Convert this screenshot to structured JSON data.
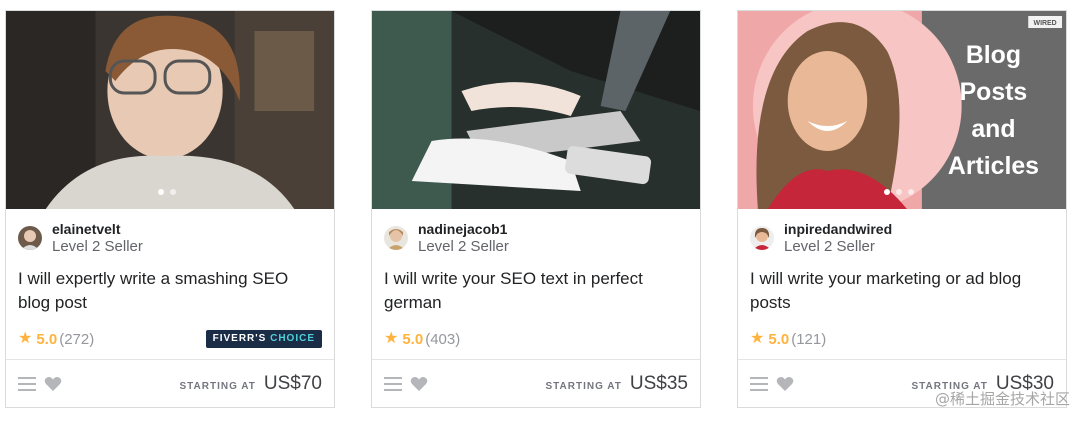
{
  "gigs": [
    {
      "seller_name": "elainetvelt",
      "seller_level": "Level 2 Seller",
      "title": "I will expertly write a smashing SEO blog post",
      "rating": "5.0",
      "rating_count": "(272)",
      "badge": {
        "prefix": "FIVERR'S",
        "suffix": "CHOICE"
      },
      "starting_at": "STARTING AT",
      "price": "US$70",
      "carousel_dots": 2,
      "carousel_active": 0
    },
    {
      "seller_name": "nadinejacob1",
      "seller_level": "Level 2 Seller",
      "title": "I will write your SEO text in perfect german",
      "rating": "5.0",
      "rating_count": "(403)",
      "starting_at": "STARTING AT",
      "price": "US$35"
    },
    {
      "seller_name": "inpiredandwired",
      "seller_level": "Level 2 Seller",
      "title": "I will write your marketing or ad blog posts",
      "rating": "5.0",
      "rating_count": "(121)",
      "starting_at": "STARTING AT",
      "price": "US$30",
      "thumbnail_text": [
        "Blog",
        "Posts",
        "and",
        "Articles"
      ],
      "thumbnail_logo": "WIRED",
      "carousel_dots": 3,
      "carousel_active": 0
    }
  ],
  "icons": {
    "star": "star-icon",
    "menu": "menu-icon",
    "heart": "heart-icon"
  },
  "colors": {
    "star": "#ffb33e",
    "badge_bg": "#1b2c47",
    "badge_accent": "#4fd1d9",
    "price": "#404145"
  },
  "watermark": "@稀土掘金技术社区"
}
